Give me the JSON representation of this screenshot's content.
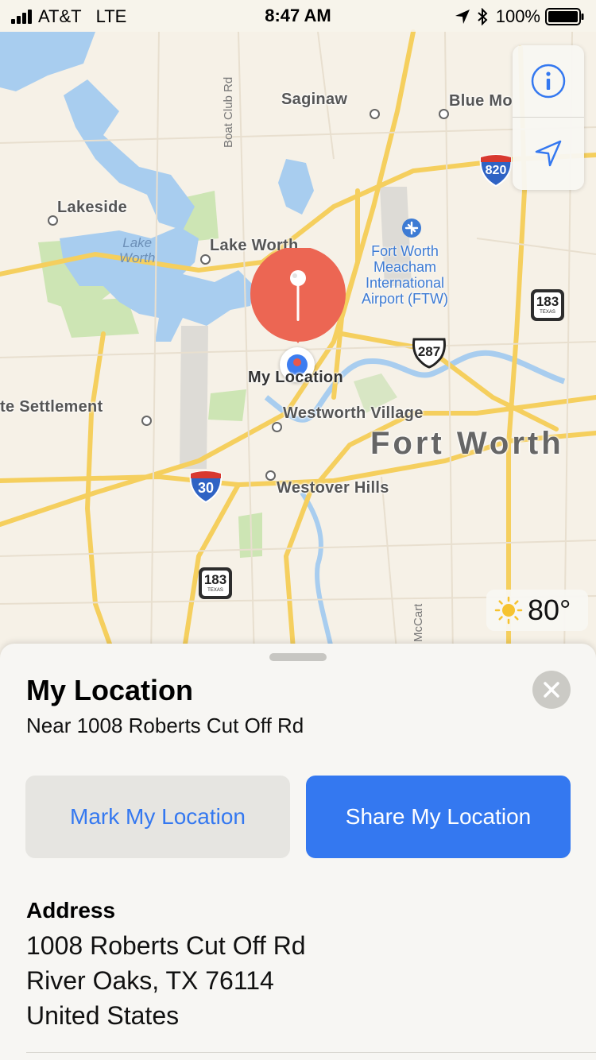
{
  "status_bar": {
    "carrier": "AT&T",
    "network": "LTE",
    "time": "8:47 AM",
    "battery": "100%"
  },
  "map": {
    "places": {
      "saginaw": "Saginaw",
      "blue_mound": "Blue Mo",
      "lakeside": "Lakeside",
      "lake_worth_city": "Lake Worth",
      "settlement": "te Settlement",
      "westworth_village": "Westworth Village",
      "fort_worth": "Fort Worth",
      "westover_hills": "Westover Hills",
      "my_location_label": "My Location"
    },
    "water": {
      "lake_worth_line1": "Lake",
      "lake_worth_line2": "Worth"
    },
    "airport": {
      "line1": "Fort Worth",
      "line2": "Meacham",
      "line3": "International",
      "line4": "Airport (FTW)"
    },
    "roads": {
      "boat_club": "Boat Club Rd",
      "mccart": "McCart",
      "i820": "820",
      "i30": "30",
      "us287": "287",
      "sh183_top": "183",
      "sh183_bottom": "183",
      "texas": "TEXAS"
    },
    "weather": {
      "icon": "sun-icon",
      "temperature": "80°"
    },
    "controls": {
      "info_icon": "info-icon",
      "location_icon": "location-arrow-icon"
    }
  },
  "sheet": {
    "title": "My Location",
    "subtitle": "Near 1008 Roberts Cut Off Rd",
    "mark_button": "Mark My Location",
    "share_button": "Share My Location",
    "address_heading": "Address",
    "address_lines": [
      "1008 Roberts Cut Off Rd",
      "River Oaks, TX  76114",
      "United States"
    ]
  },
  "colors": {
    "accent": "#3478f0",
    "pin": "#ec6653",
    "water": "#a8cdef",
    "park": "#cde5b4",
    "road": "#f5cf5e"
  }
}
